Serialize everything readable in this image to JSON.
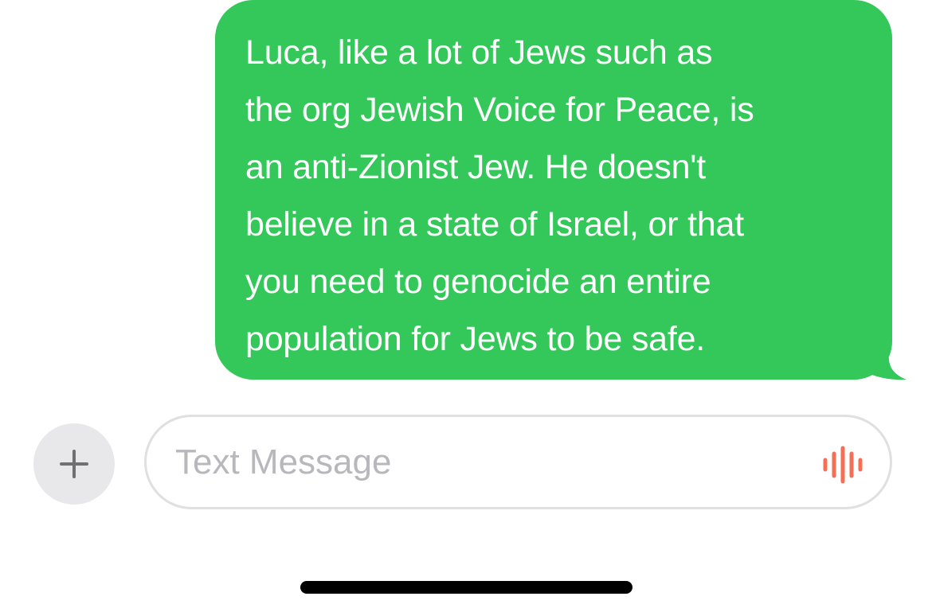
{
  "message": {
    "lines": [
      "Luca, like a lot of Jews such as",
      "the org Jewish Voice for Peace, is",
      "an anti-Zionist Jew. He doesn't",
      "believe in a state of Israel, or that",
      "you need to genocide an entire",
      "population for Jews to be safe."
    ]
  },
  "composer": {
    "add_icon": "plus-icon",
    "placeholder": "Text Message",
    "value": "",
    "audio_icon": "waveform-icon"
  },
  "colors": {
    "sent_bubble": "#34c759",
    "message_text": "#ffffff",
    "add_button_bg": "#e8e8ea",
    "add_icon": "#707074",
    "input_border": "#e0e0e2",
    "placeholder": "#b8b8bc",
    "waveform": "#f46f55",
    "home_indicator": "#000000"
  }
}
